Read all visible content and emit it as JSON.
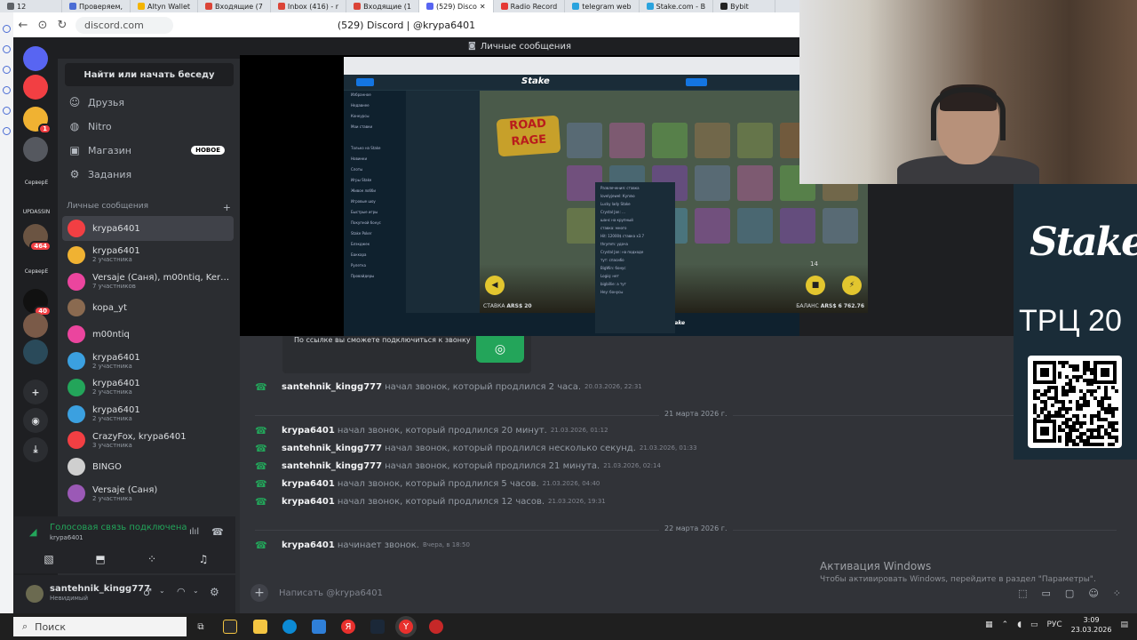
{
  "browser": {
    "tabs": [
      {
        "label": "12",
        "color": "#5f6368"
      },
      {
        "label": "Проверяем,",
        "color": "#4a6cd4"
      },
      {
        "label": "Altyn Wallet",
        "color": "#f4b400"
      },
      {
        "label": "Входящие (7",
        "color": "#db4437"
      },
      {
        "label": "Inbox (416) - r",
        "color": "#db4437"
      },
      {
        "label": "Входящие (1",
        "color": "#db4437"
      },
      {
        "label": "(529) Disco",
        "color": "#5865f2",
        "active": true
      },
      {
        "label": "Radio Record",
        "color": "#e53935"
      },
      {
        "label": "telegram web",
        "color": "#2aa3de"
      },
      {
        "label": "Stake.com - B",
        "color": "#2aa3de"
      },
      {
        "label": "Bybit",
        "color": "#222222"
      }
    ],
    "url": "discord.com",
    "title": "(529) Discord | @krypa6401"
  },
  "dm_topbar": {
    "label": "Личные сообщения"
  },
  "guilds": [
    {
      "label": "",
      "badge": "",
      "color": "#5865f2",
      "icon": "discord-home-icon"
    },
    {
      "label": "",
      "badge": "",
      "color": "#f23f43",
      "icon": "discord-icon"
    },
    {
      "label": "",
      "badge": "1",
      "color": "#f0b232",
      "icon": "person-icon"
    },
    {
      "label": "",
      "badge": "",
      "color": "#55585f",
      "icon": "avatar-icon"
    },
    {
      "label": "СерверE",
      "badge": "",
      "color": "#1e1f22",
      "icon": ""
    },
    {
      "label": "UPDASSIN",
      "badge": "24",
      "color": "#2b2d31",
      "icon": ""
    },
    {
      "label": "",
      "badge": "464",
      "color": "#6b5442",
      "icon": "avatar-icon"
    },
    {
      "label": "СерверЕ",
      "badge": "",
      "color": "#1e1f22",
      "icon": ""
    },
    {
      "label": "",
      "badge": "40",
      "color": "#111",
      "icon": "server-icon"
    },
    {
      "label": "",
      "badge": "",
      "color": "#7a5a48",
      "icon": "avatar-icon"
    },
    {
      "label": "",
      "badge": "",
      "color": "#2a4a5a",
      "icon": "avatar-icon"
    }
  ],
  "sidebar": {
    "search": "Найти или начать беседу",
    "nav": [
      {
        "label": "Друзья",
        "icon": "friends-icon"
      },
      {
        "label": "Nitro",
        "icon": "nitro-icon"
      },
      {
        "label": "Магазин",
        "icon": "shop-icon"
      },
      {
        "label": "Задания",
        "icon": "quests-icon"
      }
    ],
    "new_badge": "НОВОЕ",
    "dm_header": "Личные сообщения",
    "dms": [
      {
        "name": "krypa6401",
        "sub": "",
        "color": "#f23f43",
        "selected": true
      },
      {
        "name": "krypa6401",
        "sub": "2 участника",
        "color": "#f0b232"
      },
      {
        "name": "Versaje (Саня), m00ntiq, Ker00...",
        "sub": "7 участников",
        "color": "#eb459e"
      },
      {
        "name": "kopa_yt",
        "sub": "",
        "color": "#8a6a50"
      },
      {
        "name": "m00ntiq",
        "sub": "",
        "color": "#eb459e"
      },
      {
        "name": "krypa6401",
        "sub": "2 участника",
        "color": "#3ba0e0"
      },
      {
        "name": "krypa6401",
        "sub": "2 участника",
        "color": "#23a55a"
      },
      {
        "name": "krypa6401",
        "sub": "2 участника",
        "color": "#3ba0e0"
      },
      {
        "name": "CrazyFox, krypa6401",
        "sub": "3 участника",
        "color": "#f23f43"
      },
      {
        "name": "BINGO",
        "sub": "",
        "color": "#cfcfcf"
      },
      {
        "name": "Versaje (Саня)",
        "sub": "2 участника",
        "color": "#9b59b6"
      }
    ]
  },
  "voice": {
    "status": "Голосовая связь подключена",
    "channel": "krypa6401"
  },
  "user": {
    "name": "santehnik_kingg777",
    "status": "Невидимый"
  },
  "stream": {
    "stake_brand": "Stake",
    "side_items": [
      "Избранное",
      "Недавнее",
      "Конкурсы",
      "Мои ставки",
      "",
      "Только на Stake",
      "Новинки",
      "Слоты",
      "Игры Stake",
      "Живое лобби",
      "Игровые шоу",
      "Быстрые игры",
      "Покупной бонус",
      "Stake Poker",
      "Блэкджек",
      "Баккара",
      "Рулетка",
      "Провайдеры"
    ],
    "game_title": "ROAD RAGE",
    "bet_label": "СТАВКА",
    "bet_value": "ARS$ 20",
    "balance_label": "БАЛАНС",
    "balance_value": "ARS$ 6 762.76",
    "spins": "14",
    "chat_lines": [
      "Развлечения: ставка",
      "lovelyjewel: Куплю",
      "Lucky lady Stake",
      "Crystal Jan: ...",
      "шанс на крупный",
      "ставка: много",
      "Hit: 12000$ ставка х3.7",
      "thrymm: удача",
      "Crystal Jan: на подходе",
      "тут: спасибо",
      "BigWin: бонус",
      "Logiq: нет",
      "bigbillie: а тут",
      "Hey: бонусы"
    ]
  },
  "promo": {
    "logo": "Stake",
    "code": "ТРЦ 20"
  },
  "chat": {
    "embed_text": "По ссылке вы сможете подключиться к звонку",
    "messages": [
      {
        "author": "santehnik_kingg777",
        "text": "начал звонок, который продлился 2 часа.",
        "time": "20.03.2026, 22:31"
      },
      {
        "divider": "21 марта 2026 г."
      },
      {
        "author": "krypa6401",
        "text": "начал звонок, который продлился 20 минут.",
        "time": "21.03.2026, 01:12"
      },
      {
        "author": "santehnik_kingg777",
        "text": "начал звонок, который продлился несколько секунд.",
        "time": "21.03.2026, 01:33"
      },
      {
        "author": "santehnik_kingg777",
        "text": "начал звонок, который продлился 21 минута.",
        "time": "21.03.2026, 02:14"
      },
      {
        "author": "krypa6401",
        "text": "начал звонок, который продлился 5 часов.",
        "time": "21.03.2026, 04:40"
      },
      {
        "author": "krypa6401",
        "text": "начал звонок, который продлился 12 часов.",
        "time": "21.03.2026, 19:31"
      },
      {
        "divider": "22 марта 2026 г."
      },
      {
        "author": "krypa6401",
        "text": "начинает звонок.",
        "time": "Вчера, в 18:50"
      }
    ],
    "placeholder": "Написать @krypa6401"
  },
  "activation": {
    "title": "Активация Windows",
    "subtitle": "Чтобы активировать Windows, перейдите в раздел \"Параметры\"."
  },
  "taskbar": {
    "search": "Поиск",
    "lang": "РУС",
    "time": "3:09",
    "date": "23.03.2026"
  }
}
